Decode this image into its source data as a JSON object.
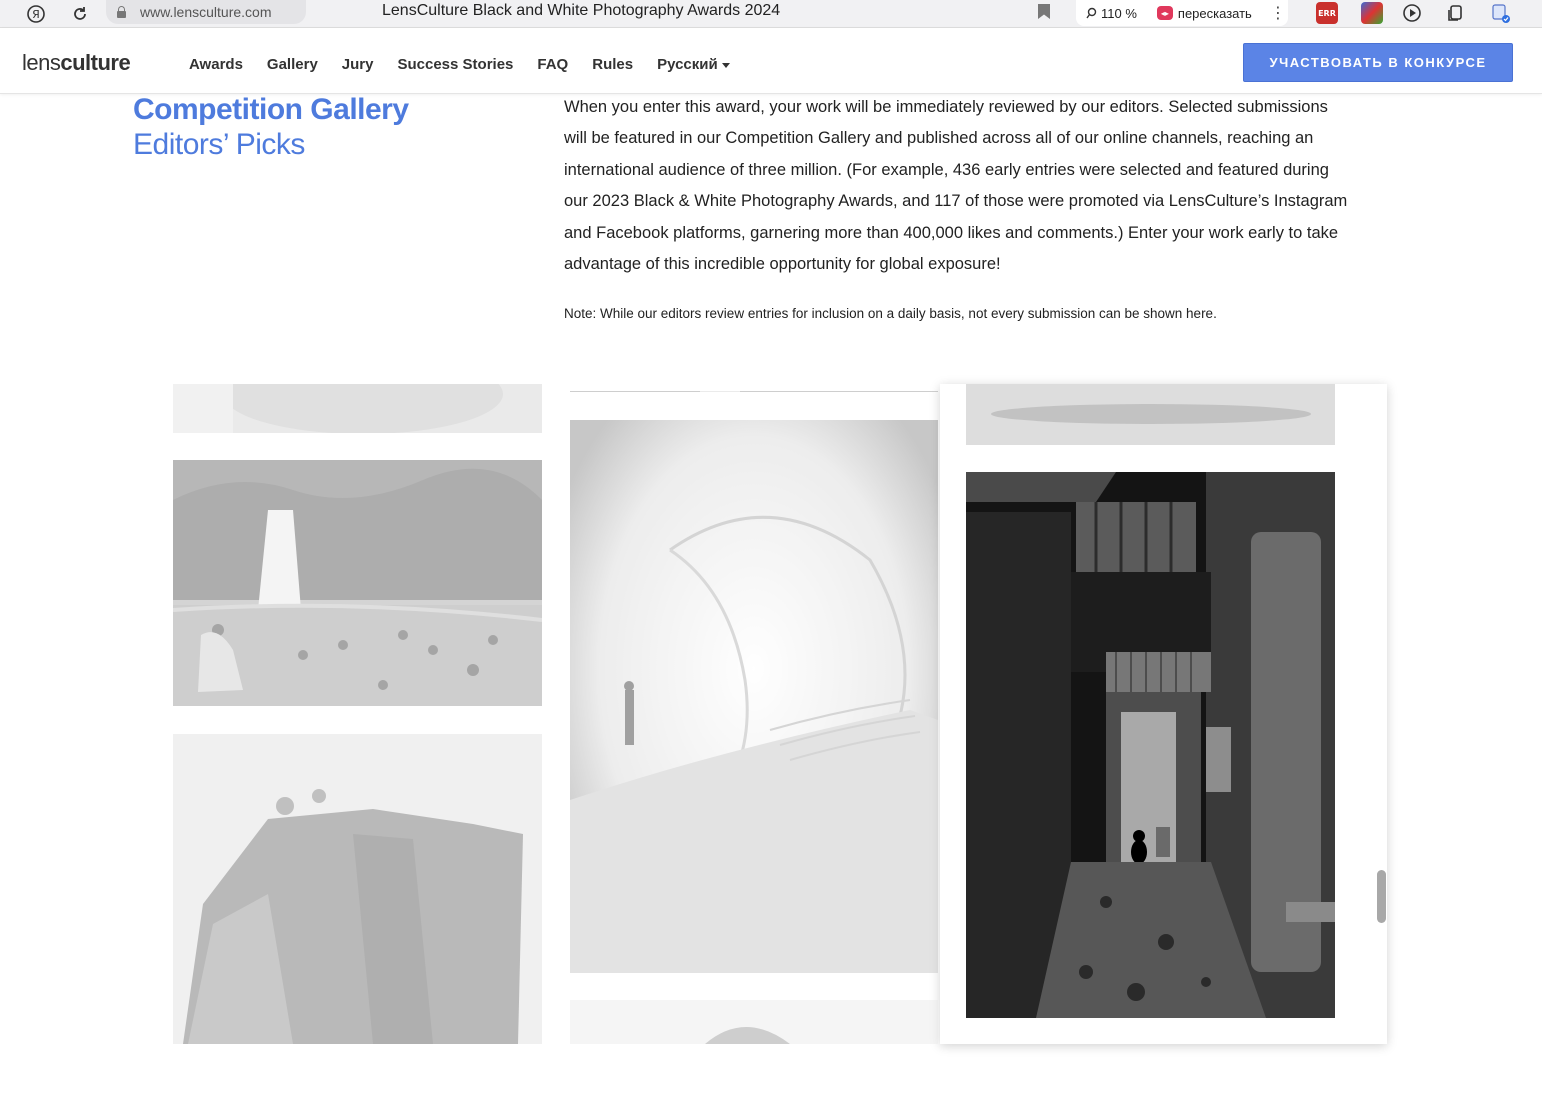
{
  "browser": {
    "url": "www.lensculture.com",
    "tab_title": "LensCulture Black and White Photography Awards 2024",
    "zoom": "110 %",
    "retell_label": "пересказать",
    "ext_err_label": "ERR"
  },
  "header": {
    "logo_regular": "lens",
    "logo_bold": "culture",
    "nav": [
      "Awards",
      "Gallery",
      "Jury",
      "Success Stories",
      "FAQ",
      "Rules"
    ],
    "language": "Русский",
    "cta_label": "УЧАСТВОВАТЬ В КОНКУРСЕ"
  },
  "content": {
    "title": "Competition Gallery",
    "subtitle": "Editors’ Picks",
    "intro": "When you enter this award, your work will be immediately reviewed by our editors. Selected submissions will be featured in our Competition Gallery and published across all of our online channels, reaching an international audience of three million. (For example, 436 early entries were selected and featured during our 2023 Black & White Photography Awards, and 117 of those were promoted via LensCulture’s Instagram and Facebook platforms, garnering more than 400,000 likes and comments.) Enter your work early to take advantage of this incredible opportunity for global exposure!",
    "note": "Note: While our editors review entries for inclusion on a daily basis, not every submission can be shown here."
  },
  "gallery": {
    "photos": [
      "portrait-crop",
      "waterfall-swimmers",
      "cliff-in-fog",
      "abstract-stairs-figure",
      "blurred-landscape",
      "alley-with-cat",
      "portrait-top",
      "partial-top"
    ]
  }
}
